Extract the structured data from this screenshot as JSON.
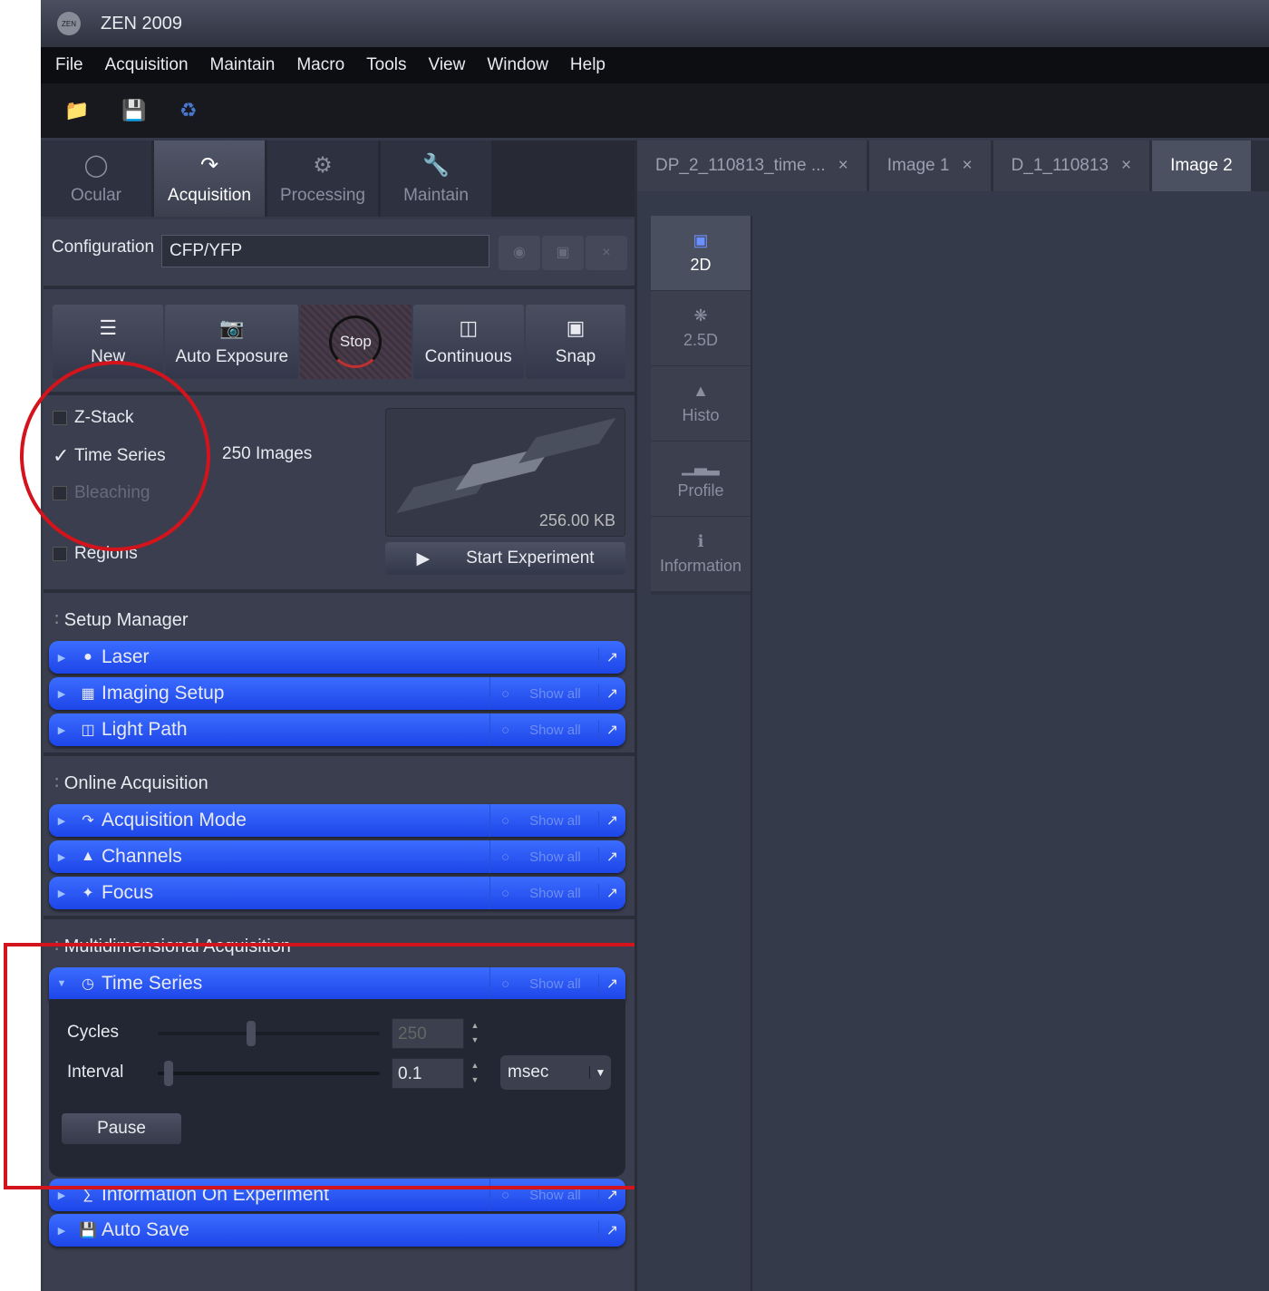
{
  "title": "ZEN 2009",
  "menu": [
    "File",
    "Acquisition",
    "Maintain",
    "Macro",
    "Tools",
    "View",
    "Window",
    "Help"
  ],
  "main_tabs": [
    {
      "label": "Ocular",
      "icon": "ocular-icon"
    },
    {
      "label": "Acquisition",
      "icon": "acquisition-icon"
    },
    {
      "label": "Processing",
      "icon": "gear-icon"
    },
    {
      "label": "Maintain",
      "icon": "wrench-icon"
    }
  ],
  "config": {
    "label": "Configuration",
    "value": "CFP/YFP"
  },
  "actions": {
    "new": "New",
    "auto_exposure": "Auto Exposure",
    "stop": "Stop",
    "continuous": "Continuous",
    "snap": "Snap"
  },
  "options": {
    "z_stack": "Z-Stack",
    "time_series": "Time Series",
    "bleaching": "Bleaching",
    "regions": "Regions",
    "images": "250 Images",
    "size": "256.00 KB",
    "start": "Start Experiment"
  },
  "sections": {
    "setup": "Setup Manager",
    "online": "Online Acquisition",
    "multi": "Multidimensional Acquisition"
  },
  "show_all": "Show all",
  "tools": {
    "laser": "Laser",
    "imaging": "Imaging Setup",
    "lightpath": "Light Path",
    "acqmode": "Acquisition Mode",
    "channels": "Channels",
    "focus": "Focus",
    "timeseries": "Time Series",
    "info": "Information On Experiment",
    "autosave": "Auto Save"
  },
  "time_series": {
    "cycles_label": "Cycles",
    "cycles": "250",
    "cycles_fraction": 0.4,
    "interval_label": "Interval",
    "interval": "0.1",
    "interval_fraction": 0.03,
    "unit": "msec",
    "pause": "Pause"
  },
  "doc_tabs": [
    "DP_2_110813_time ...",
    "Image 1",
    "D_1_110813",
    "Image 2"
  ],
  "view_tabs": [
    "2D",
    "2.5D",
    "Histo",
    "Profile",
    "Information"
  ],
  "colors": {
    "accent": "#2a55f5",
    "highlight": "#d4141c"
  }
}
